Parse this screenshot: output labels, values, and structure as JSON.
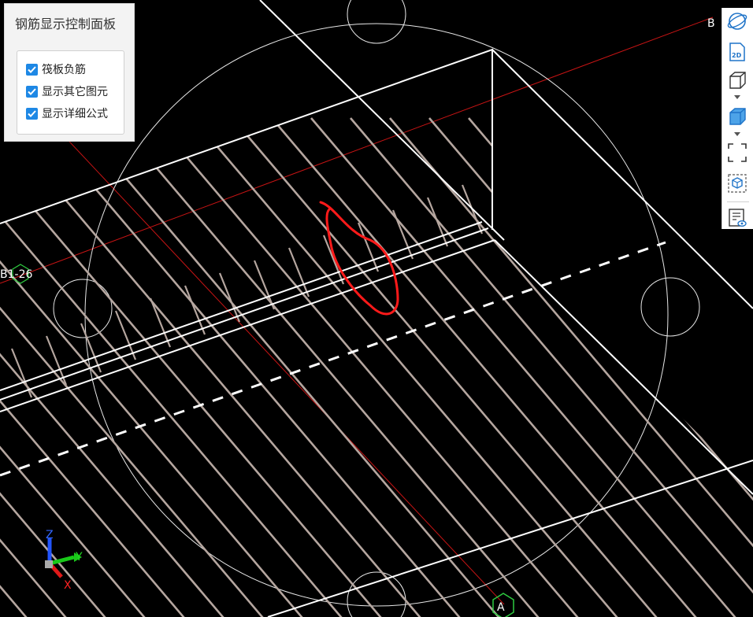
{
  "panel": {
    "title": "钢筋显示控制面板",
    "options": [
      {
        "label": "筏板负筋",
        "checked": true
      },
      {
        "label": "显示其它图元",
        "checked": true
      },
      {
        "label": "显示详细公式",
        "checked": true
      }
    ]
  },
  "toolbar": {
    "buttons": [
      {
        "name": "orbit",
        "icon": "orbit-icon"
      },
      {
        "name": "2d",
        "label": "2D",
        "icon": "2d-view-icon"
      },
      {
        "name": "cube-view",
        "icon": "wireframe-cube-icon"
      },
      {
        "name": "solid-view",
        "icon": "solid-cube-icon"
      },
      {
        "name": "fit",
        "icon": "fullscreen-frame-icon"
      },
      {
        "name": "dynamic-observe",
        "icon": "dashed-cube-icon"
      },
      {
        "name": "report",
        "icon": "report-eye-icon"
      }
    ]
  },
  "viewport": {
    "grid_axes": [
      "A",
      "B"
    ],
    "member_label": "B1-26",
    "axis_indicator": {
      "x": "X",
      "y": "Y",
      "z": "Z"
    },
    "colors": {
      "background": "#000000",
      "rebar": "#b5a69f",
      "edges": "#ffffff",
      "axis_line": "#d01010",
      "markup": "#ff1a1a",
      "grid_marker": "#2ecc40"
    }
  }
}
